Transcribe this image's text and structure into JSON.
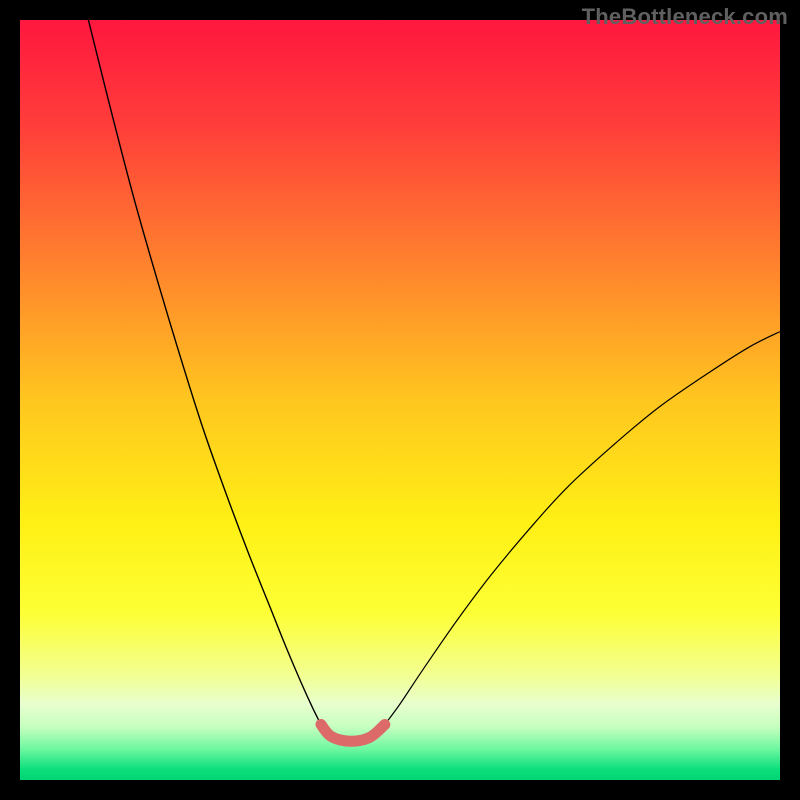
{
  "watermark": "TheBottleneck.com",
  "chart_data": {
    "type": "line",
    "title": "",
    "xlabel": "",
    "ylabel": "",
    "xlim": [
      0,
      100
    ],
    "ylim": [
      0,
      100
    ],
    "background_gradient_stops": [
      {
        "pos": 0.0,
        "color": "#ff173f"
      },
      {
        "pos": 0.14,
        "color": "#ff3e3a"
      },
      {
        "pos": 0.3,
        "color": "#ff7a2f"
      },
      {
        "pos": 0.5,
        "color": "#ffc61f"
      },
      {
        "pos": 0.66,
        "color": "#fff015"
      },
      {
        "pos": 0.78,
        "color": "#fdff35"
      },
      {
        "pos": 0.86,
        "color": "#f3ff8f"
      },
      {
        "pos": 0.9,
        "color": "#e8ffce"
      },
      {
        "pos": 0.93,
        "color": "#c7ffc0"
      },
      {
        "pos": 0.96,
        "color": "#6bf79f"
      },
      {
        "pos": 0.985,
        "color": "#0fe07e"
      },
      {
        "pos": 1.0,
        "color": "#00d474"
      }
    ],
    "series": [
      {
        "name": "left-branch",
        "type": "curve",
        "stroke": "#000000",
        "width": 1.4,
        "points": [
          {
            "x": 9.0,
            "y": 100.0
          },
          {
            "x": 12.0,
            "y": 88.0
          },
          {
            "x": 15.0,
            "y": 76.5
          },
          {
            "x": 18.0,
            "y": 66.0
          },
          {
            "x": 21.0,
            "y": 56.0
          },
          {
            "x": 24.0,
            "y": 46.5
          },
          {
            "x": 27.0,
            "y": 38.0
          },
          {
            "x": 30.0,
            "y": 30.0
          },
          {
            "x": 33.0,
            "y": 22.5
          },
          {
            "x": 35.0,
            "y": 17.5
          },
          {
            "x": 37.0,
            "y": 12.8
          },
          {
            "x": 38.5,
            "y": 9.5
          },
          {
            "x": 39.6,
            "y": 7.3
          }
        ]
      },
      {
        "name": "right-branch",
        "type": "curve",
        "stroke": "#000000",
        "width": 1.2,
        "points": [
          {
            "x": 48.0,
            "y": 7.3
          },
          {
            "x": 50.0,
            "y": 10.0
          },
          {
            "x": 53.0,
            "y": 14.5
          },
          {
            "x": 57.5,
            "y": 21.0
          },
          {
            "x": 62.0,
            "y": 27.0
          },
          {
            "x": 67.0,
            "y": 33.0
          },
          {
            "x": 72.0,
            "y": 38.5
          },
          {
            "x": 78.0,
            "y": 44.0
          },
          {
            "x": 84.0,
            "y": 49.0
          },
          {
            "x": 90.5,
            "y": 53.5
          },
          {
            "x": 96.0,
            "y": 57.0
          },
          {
            "x": 100.0,
            "y": 59.0
          }
        ]
      },
      {
        "name": "bottom-flat",
        "type": "curve",
        "stroke": "#000000",
        "width": 1.2,
        "points": [
          {
            "x": 39.6,
            "y": 7.3
          },
          {
            "x": 41.0,
            "y": 5.7
          },
          {
            "x": 43.5,
            "y": 5.1
          },
          {
            "x": 46.0,
            "y": 5.6
          },
          {
            "x": 48.0,
            "y": 7.3
          }
        ]
      },
      {
        "name": "highlight-segment",
        "type": "curve",
        "stroke": "#db6a68",
        "width": 11,
        "linecap": "round",
        "points": [
          {
            "x": 39.6,
            "y": 7.3
          },
          {
            "x": 41.0,
            "y": 5.7
          },
          {
            "x": 43.5,
            "y": 5.1
          },
          {
            "x": 46.0,
            "y": 5.6
          },
          {
            "x": 48.0,
            "y": 7.3
          }
        ]
      }
    ]
  }
}
